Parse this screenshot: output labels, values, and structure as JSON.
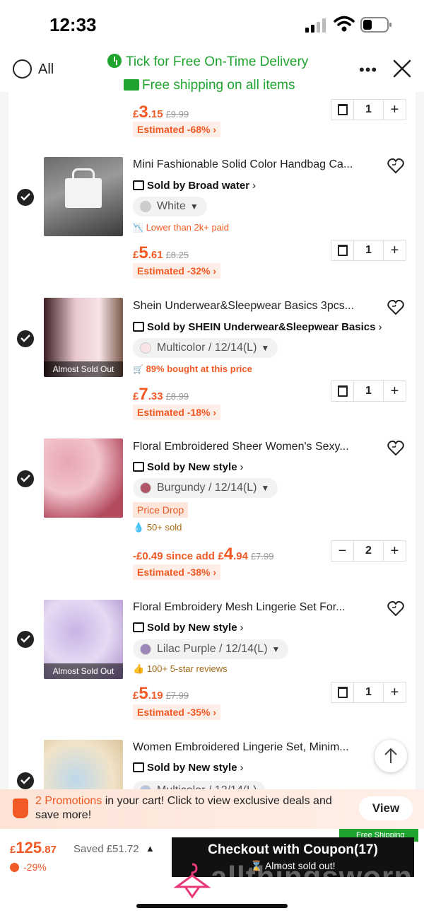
{
  "status_bar": {
    "time": "12:33"
  },
  "header": {
    "all_label": "All",
    "delivery_text": "Tick for Free On-Time Delivery",
    "shipping_text": "Free shipping on all items"
  },
  "items": [
    {
      "price": {
        "currency": "£",
        "int": "3",
        "dec": ".15",
        "old": "£9.99"
      },
      "estimated": "Estimated -68% ›",
      "qty": "1"
    },
    {
      "title": "Mini Fashionable Solid Color Handbag Ca...",
      "seller": "Sold by Broad water",
      "variant": "White",
      "note": "Lower than 2k+ paid",
      "price": {
        "currency": "£",
        "int": "5",
        "dec": ".61",
        "old": "£8.25"
      },
      "estimated": "Estimated -32% ›",
      "qty": "1"
    },
    {
      "title": "Shein Underwear&Sleepwear Basics 3pcs...",
      "seller": "Sold by SHEIN Underwear&Sleepwear Basics",
      "variant": "Multicolor / 12/14(L)",
      "badge": "Almost Sold Out",
      "note": "89% bought at this price",
      "price": {
        "currency": "£",
        "int": "7",
        "dec": ".33",
        "old": "£8.99"
      },
      "estimated": "Estimated -18% ›",
      "qty": "1"
    },
    {
      "title": "Floral Embroidered Sheer Women's Sexy...",
      "seller": "Sold by New style",
      "variant": "Burgundy / 12/14(L)",
      "tag": "Price Drop",
      "note": "50+ sold",
      "since_add": "-£0.49 since add",
      "price": {
        "currency": "£",
        "int": "4",
        "dec": ".94",
        "old": "£7.99"
      },
      "estimated": "Estimated -38% ›",
      "qty": "2"
    },
    {
      "title": "Floral Embroidery Mesh Lingerie Set For...",
      "seller": "Sold by New style",
      "variant": "Lilac Purple / 12/14(L)",
      "badge": "Almost Sold Out",
      "note": "100+ 5-star reviews",
      "price": {
        "currency": "£",
        "int": "5",
        "dec": ".19",
        "old": "£7.99"
      },
      "estimated": "Estimated -35% ›",
      "qty": "1"
    },
    {
      "title": "Women Embroidered Lingerie Set, Minim...",
      "seller": "Sold by New style",
      "variant": "Multicolor / 12/14(L)"
    }
  ],
  "promo": {
    "highlight": "2 Promotions",
    "text": " in your cart! Click to view exclusive deals and save more!",
    "view_label": "View"
  },
  "checkout": {
    "total": {
      "currency": "£",
      "int": "125",
      "dec": ".87"
    },
    "saved": "Saved £51.72",
    "percent": "-29%",
    "free_shipping": "Free Shipping",
    "button_label": "Checkout with Coupon(17)",
    "button_sub": "Almost sold out!",
    "watermark": "allthingsworn"
  },
  "colors": {
    "accent": "#f15a24",
    "green": "#1fa52f",
    "dark": "#111111"
  }
}
